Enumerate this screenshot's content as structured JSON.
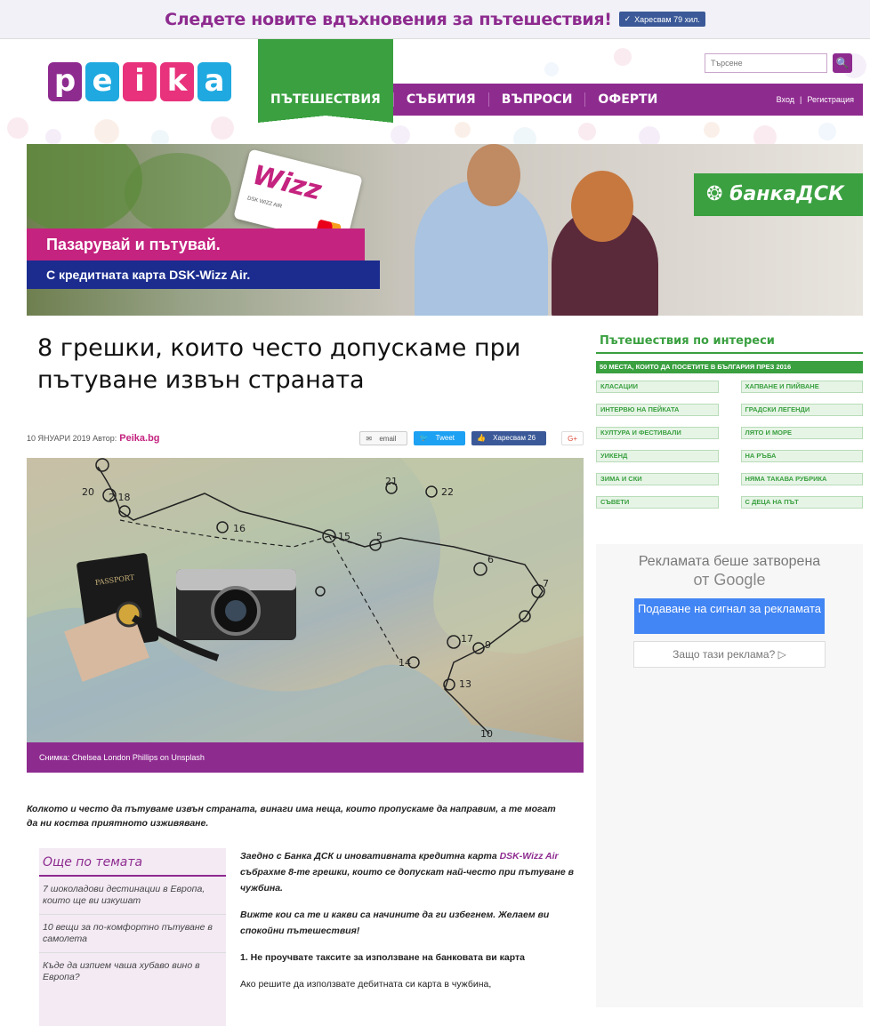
{
  "topbar": {
    "message": "Следете новите вдъхновения за пътешествия!",
    "fb_like": "Харесвам 79 хил."
  },
  "header": {
    "logo_letters": [
      "p",
      "e",
      "i",
      "k",
      "a"
    ],
    "logo_colors": [
      "#8e2b8f",
      "#1fa9e0",
      "#e8327c",
      "#e8327c",
      "#1fa9e0"
    ],
    "search_placeholder": "Търсене",
    "search_button": "🔍",
    "nav": [
      "ПЪТЕШЕСТВИЯ",
      "СЪБИТИЯ",
      "ВЪПРОСИ",
      "ОФЕРТИ"
    ],
    "login": "Вход",
    "auth_sep": "|",
    "register": "Регистрация"
  },
  "banner": {
    "card_brand": "Wizz",
    "card_name": "DSK WIZZ AIR",
    "line1": "Пазарувай и пътувай.",
    "line2": "С кредитната карта DSK-Wizz Air.",
    "bank": "банкаДСК"
  },
  "article": {
    "title": "8 грешки, които често допускаме при пътуване извън страната",
    "date": "10 ЯНУАРИ 2019",
    "author_label": "Автор:",
    "author": "Peika.bg",
    "share_email": "email",
    "share_tweet": "Tweet",
    "share_fb": "Харесвам 26",
    "share_g": "G+",
    "caption": "Снимка: Chelsea London Phillips on Unsplash",
    "lead": "Колкото и често да пътуваме извън страната, винаги има неща, които пропускаме да направим, а те могат да ни коства приятното изживяване.",
    "p1a": "Заедно с Банка ДСК и иновативната кредитна карта ",
    "p1b": "DSK-Wizz Air",
    "p1c": " събрахме 8-те грешки, които се допускат най-често при пътуване в чужбина.",
    "p2": "Вижте кои са те и какви са начините да ги избегнем. Желаем ви спокойни пътешествия!",
    "p3": "1. Не проучвате таксите за използване на банковата ви карта",
    "p4": "Ако решите да използвате дебитната си карта в чужбина,"
  },
  "more": {
    "heading": "Още по темата",
    "links": [
      "7 шоколадови дестинации в Европа, които ще ви изкушат",
      "10 вещи за по-комфортно пътуване в самолета",
      "Къде да изпием чаша хубаво вино в Европа?"
    ]
  },
  "sidebar": {
    "heading": "Пътешествия по интереси",
    "wide_tag": "50 МЕСТА, КОИТО ДА ПОСЕТИТЕ В БЪЛГАРИЯ ПРЕЗ 2016",
    "tags": [
      "КЛАСАЦИИ",
      "ХАПВАНЕ И ПИЙВАНЕ",
      "ИНТЕРВЮ НА ПЕЙКАТА",
      "ГРАДСКИ ЛЕГЕНДИ",
      "КУЛТУРА И ФЕСТИВАЛИ",
      "ЛЯТО И МОРЕ",
      "УИКЕНД",
      "НА РЪБА",
      "ЗИМА И СКИ",
      "НЯМА ТАКАВА РУБРИКА",
      "СЪВЕТИ",
      "С ДЕЦА НА ПЪТ"
    ]
  },
  "ad": {
    "closed_1": "Рекламата беше затворена",
    "closed_2": "от Google",
    "report": "Подаване на сигнал за рекламата",
    "why": "Защо тази реклама? ▷"
  },
  "colors": {
    "purple": "#8e2b8f",
    "green": "#3aa040",
    "pink": "#c4237f",
    "navy": "#1b2c8e"
  }
}
